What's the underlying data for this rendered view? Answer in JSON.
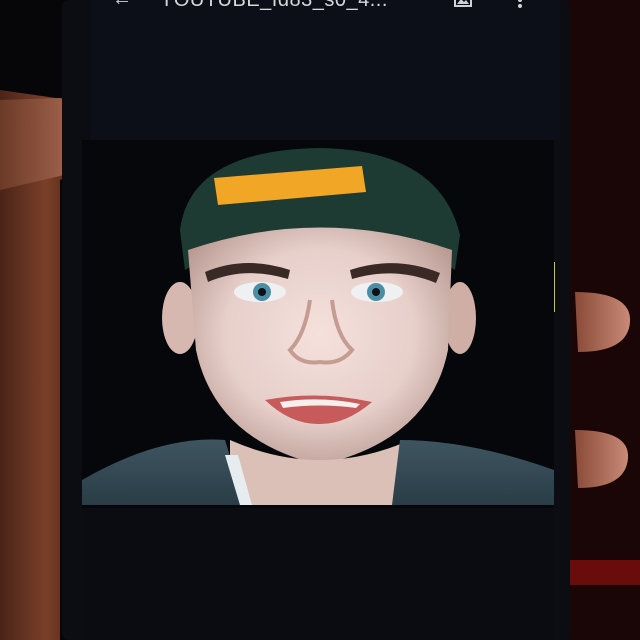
{
  "app_bar": {
    "title": "YOUTUBE_Id83_s0_4...",
    "back_icon": "arrow-left-icon",
    "gallery_icon": "gallery-icon",
    "more_icon": "more-vertical-icon",
    "icon_color": "#cfd2d6"
  },
  "photo": {
    "icon": "photo-of-face",
    "cap_colors": {
      "crown": "#1d3b32",
      "strap": "#f2a625"
    }
  }
}
